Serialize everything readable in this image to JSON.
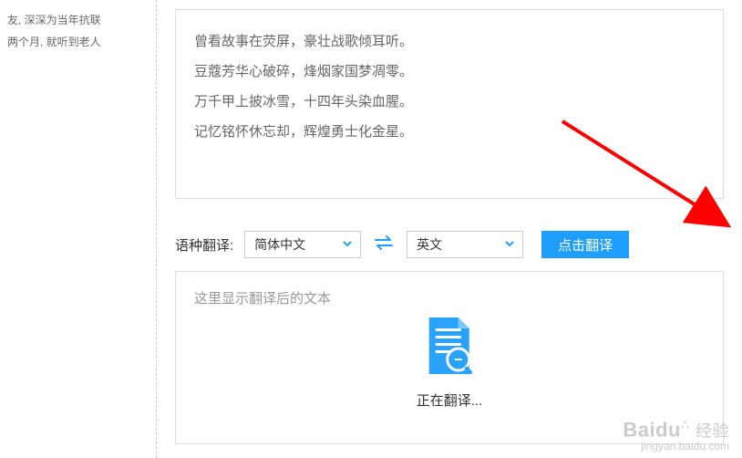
{
  "sidebar": {
    "line1": "友, 深深为当年抗联",
    "line2": "两个月, 就听到老人"
  },
  "input": {
    "lines": [
      "曾看故事在荧屏，豪壮战歌倾耳听。",
      "豆蔻芳华心破碎，烽烟家国梦凋零。",
      "万千甲上披冰雪，十四年头染血腥。",
      "记忆铭怀休忘却，辉煌勇士化金星。"
    ]
  },
  "controls": {
    "label": "语种翻译:",
    "source": "简体中文",
    "target": "英文",
    "button": "点击翻译"
  },
  "output": {
    "placeholder": "这里显示翻译后的文本",
    "loading": "正在翻译..."
  },
  "watermark": {
    "brand": "Baidu",
    "suffix": "经验",
    "url": "jingyan.baidu.com"
  }
}
